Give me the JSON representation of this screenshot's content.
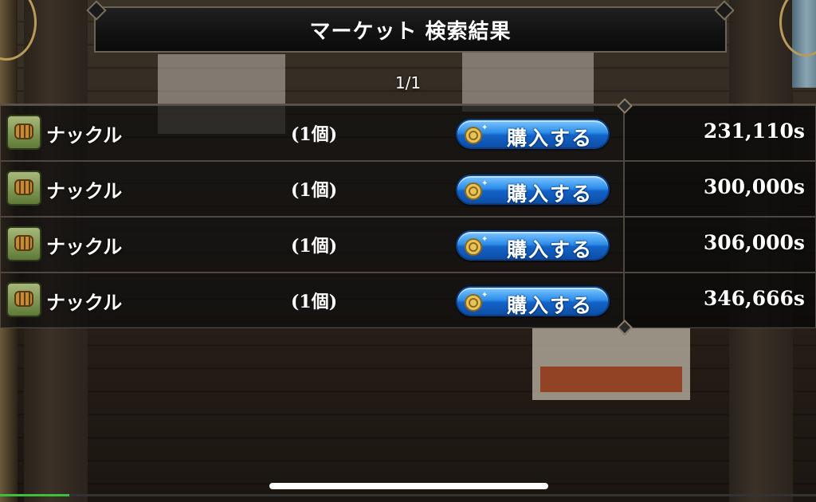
{
  "title": "マーケット 検索結果",
  "page_indicator": "1/1",
  "listings": [
    {
      "name": "ナックル",
      "quantity": "(1個)",
      "buy_label": "購入する",
      "price": "231,110s"
    },
    {
      "name": "ナックル",
      "quantity": "(1個)",
      "buy_label": "購入する",
      "price": "300,000s"
    },
    {
      "name": "ナックル",
      "quantity": "(1個)",
      "buy_label": "購入する",
      "price": "306,000s"
    },
    {
      "name": "ナックル",
      "quantity": "(1個)",
      "buy_label": "購入する",
      "price": "346,666s"
    }
  ],
  "icons": {
    "item": "knuckle-icon",
    "buy": "coin-icon"
  },
  "colors": {
    "button_blue": "#2d8eea",
    "panel_dark": "#111111",
    "progress_green": "#3cbf3c"
  },
  "progress_fraction": 0.085
}
